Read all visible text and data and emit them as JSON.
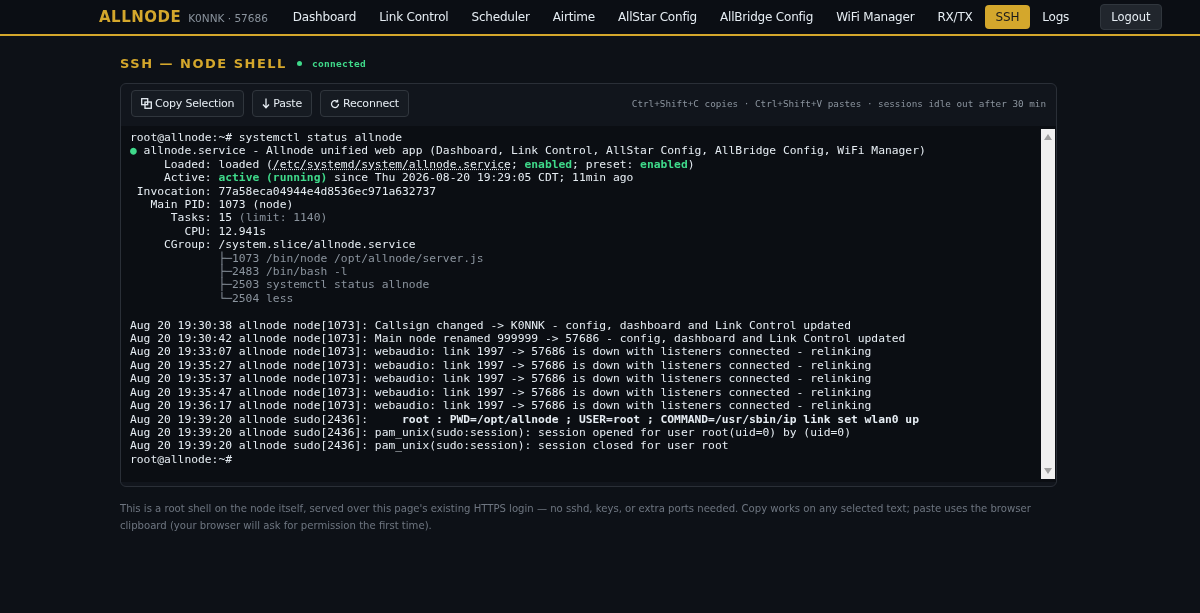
{
  "brand": {
    "logo": "ALLNODE",
    "subtitle": "K0NNK · 57686"
  },
  "nav": [
    {
      "label": "Dashboard",
      "selected": false
    },
    {
      "label": "Link Control",
      "selected": false
    },
    {
      "label": "Scheduler",
      "selected": false
    },
    {
      "label": "Airtime",
      "selected": false
    },
    {
      "label": "AllStar Config",
      "selected": false
    },
    {
      "label": "AllBridge Config",
      "selected": false
    },
    {
      "label": "WiFi Manager",
      "selected": false
    },
    {
      "label": "RX/TX",
      "selected": false
    },
    {
      "label": "SSH",
      "selected": true
    },
    {
      "label": "Logs",
      "selected": false
    }
  ],
  "logout": "Logout",
  "page": {
    "title": "SSH — NODE SHELL",
    "status": "connected",
    "connected": true
  },
  "toolbar": {
    "buttons": [
      {
        "label": "Copy Selection",
        "kind": "copy"
      },
      {
        "label": "Paste",
        "kind": "paste"
      },
      {
        "label": "Reconnect",
        "kind": "reconnect"
      }
    ],
    "hint": "Ctrl+Shift+C copies · Ctrl+Shift+V pastes · sessions idle out after 30 min"
  },
  "terminal": {
    "lines": [
      {
        "segments": [
          {
            "kind": "plain",
            "text": "root@allnode:~# systemctl status allnode"
          }
        ]
      },
      {
        "segments": [
          {
            "kind": "dot",
            "text": "●"
          },
          {
            "kind": "plain",
            "text": " allnode.service - Allnode unified web app (Dashboard, Link Control, AllStar Config, AllBridge Config, WiFi Manager)"
          }
        ]
      },
      {
        "segments": [
          {
            "kind": "plain",
            "text": "     Loaded: loaded ("
          },
          {
            "kind": "path",
            "text": "/etc/systemd/system/allnode.service"
          },
          {
            "kind": "plain",
            "text": "; "
          },
          {
            "kind": "ok",
            "text": "enabled"
          },
          {
            "kind": "plain",
            "text": "; preset: "
          },
          {
            "kind": "ok",
            "text": "enabled"
          },
          {
            "kind": "plain",
            "text": ")"
          }
        ]
      },
      {
        "segments": [
          {
            "kind": "plain",
            "text": "     Active: "
          },
          {
            "kind": "ok",
            "text": "active (running)"
          },
          {
            "kind": "plain",
            "text": " since Thu 2026-08-20 19:29:05 CDT; 11min ago"
          }
        ]
      },
      {
        "segments": [
          {
            "kind": "plain",
            "text": " Invocation: 77a58eca04944e4d8536ec971a632737"
          }
        ]
      },
      {
        "segments": [
          {
            "kind": "plain",
            "text": "   Main PID: 1073 (node)"
          }
        ]
      },
      {
        "segments": [
          {
            "kind": "plain",
            "text": "      Tasks: 15 "
          },
          {
            "kind": "dim",
            "text": "(limit: 1140)"
          }
        ]
      },
      {
        "segments": [
          {
            "kind": "plain",
            "text": "        CPU: 12.941s"
          }
        ]
      },
      {
        "segments": [
          {
            "kind": "plain",
            "text": "     CGroup: /system.slice/allnode.service"
          }
        ]
      },
      {
        "segments": [
          {
            "kind": "dim",
            "text": "             ├─1073 /bin/node /opt/allnode/server.js"
          }
        ]
      },
      {
        "segments": [
          {
            "kind": "dim",
            "text": "             ├─2483 /bin/bash -l"
          }
        ]
      },
      {
        "segments": [
          {
            "kind": "dim",
            "text": "             ├─2503 systemctl status allnode"
          }
        ]
      },
      {
        "segments": [
          {
            "kind": "dim",
            "text": "             └─2504 less"
          }
        ]
      },
      {
        "kind": "blank"
      },
      {
        "segments": [
          {
            "kind": "plain",
            "text": "Aug 20 19:30:38 allnode node[1073]: Callsign changed -> K0NNK - config, dashboard and Link Control updated"
          }
        ]
      },
      {
        "segments": [
          {
            "kind": "plain",
            "text": "Aug 20 19:30:42 allnode node[1073]: Main node renamed 999999 -> 57686 - config, dashboard and Link Control updated"
          }
        ]
      },
      {
        "segments": [
          {
            "kind": "plain",
            "text": "Aug 20 19:33:07 allnode node[1073]: webaudio: link 1997 -> 57686 is down with listeners connected - relinking"
          }
        ]
      },
      {
        "segments": [
          {
            "kind": "plain",
            "text": "Aug 20 19:35:27 allnode node[1073]: webaudio: link 1997 -> 57686 is down with listeners connected - relinking"
          }
        ]
      },
      {
        "segments": [
          {
            "kind": "plain",
            "text": "Aug 20 19:35:37 allnode node[1073]: webaudio: link 1997 -> 57686 is down with listeners connected - relinking"
          }
        ]
      },
      {
        "segments": [
          {
            "kind": "plain",
            "text": "Aug 20 19:35:47 allnode node[1073]: webaudio: link 1997 -> 57686 is down with listeners connected - relinking"
          }
        ]
      },
      {
        "segments": [
          {
            "kind": "plain",
            "text": "Aug 20 19:36:17 allnode node[1073]: webaudio: link 1997 -> 57686 is down with listeners connected - relinking"
          }
        ]
      },
      {
        "segments": [
          {
            "kind": "plain",
            "text": "Aug 20 19:39:20 allnode sudo[2436]: "
          },
          {
            "kind": "bold",
            "text": "    root : PWD=/opt/allnode ; USER=root ; COMMAND=/usr/sbin/ip link set wlan0 up"
          }
        ]
      },
      {
        "segments": [
          {
            "kind": "plain",
            "text": "Aug 20 19:39:20 allnode sudo[2436]: pam_unix(sudo:session): session opened for user root(uid=0) by (uid=0)"
          }
        ]
      },
      {
        "segments": [
          {
            "kind": "plain",
            "text": "Aug 20 19:39:20 allnode sudo[2436]: pam_unix(sudo:session): session closed for user root"
          }
        ]
      },
      {
        "segments": [
          {
            "kind": "plain",
            "text": "root@allnode:~#"
          }
        ]
      }
    ]
  },
  "footnote": "This is a root shell on the node itself, served over this page's existing HTTPS login — no sshd, keys, or extra ports needed. Copy works on any selected text; paste uses the browser clipboard (your browser will ask for permission the first time)."
}
